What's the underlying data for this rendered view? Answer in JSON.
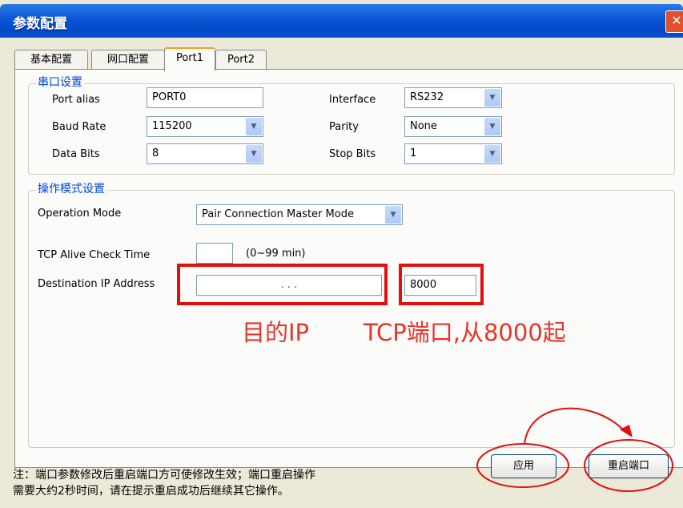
{
  "window": {
    "title": "参数配置",
    "close_glyph": "✕"
  },
  "tabs": [
    {
      "label": "基本配置"
    },
    {
      "label": "网口配置"
    },
    {
      "label": "Port1"
    },
    {
      "label": "Port2"
    }
  ],
  "serial": {
    "legend": "串口设置",
    "port_alias": {
      "label": "Port alias",
      "value": "PORT0"
    },
    "baud_rate": {
      "label": "Baud Rate",
      "value": "115200"
    },
    "data_bits": {
      "label": "Data Bits",
      "value": "8"
    },
    "interface": {
      "label": "Interface",
      "value": "RS232"
    },
    "parity": {
      "label": "Parity",
      "value": "None"
    },
    "stop_bits": {
      "label": "Stop Bits",
      "value": "1"
    }
  },
  "operation": {
    "legend": "操作模式设置",
    "mode": {
      "label": "Operation Mode",
      "value": "Pair Connection Master Mode"
    },
    "alive": {
      "label": "TCP Alive Check Time",
      "value": "",
      "hint": "(0~99 min)"
    },
    "dest": {
      "label": "Destination IP Address",
      "ip": ".      .      .",
      "port": "8000"
    }
  },
  "annotations": {
    "ip": "目的IP",
    "port": "TCP端口,从8000起"
  },
  "buttons": {
    "apply": "应用",
    "restart": "重启端口"
  },
  "note": {
    "line1": "注：端口参数修改后重启端口方可使修改生效；端口重启操作",
    "line2": "需要大约2秒时间，请在提示重启成功后继续其它操作。"
  },
  "colors": {
    "annotation": "#e01010",
    "legend": "#0046d5",
    "titlebar": "#0a55d6"
  }
}
